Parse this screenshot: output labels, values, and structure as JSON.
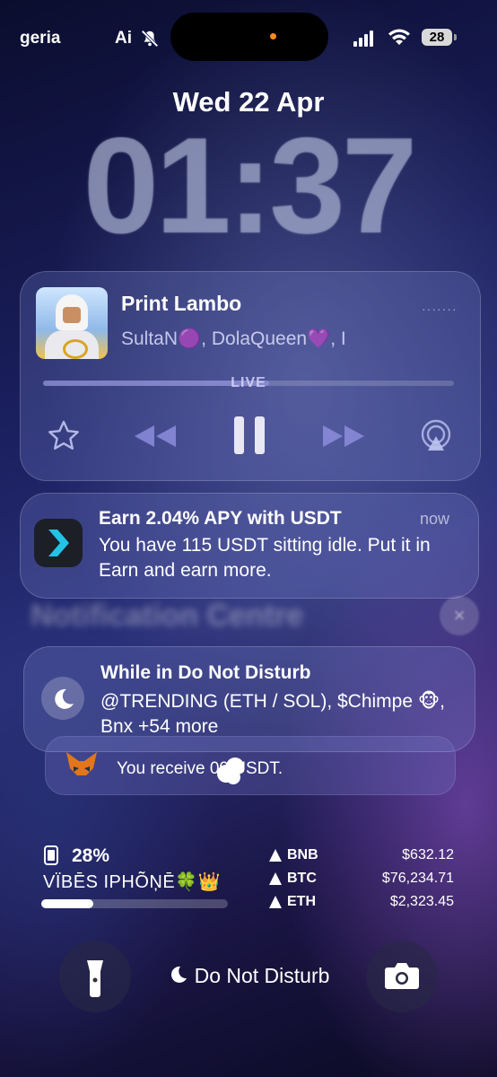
{
  "status_bar": {
    "carrier": "geria",
    "ai_label": "Ai",
    "battery_level": "28",
    "signal_bars": 4
  },
  "lock_screen": {
    "date": "Wed 22 Apr",
    "time": "01:37"
  },
  "now_playing": {
    "title": "Print Lambo",
    "artists": "SultaN🟣, DolaQueen💜, I",
    "live_label": "LIVE",
    "progress": 0.55,
    "controls": [
      "star-icon",
      "rewind-icon",
      "pause-icon",
      "fast-forward-icon",
      "airplay-icon"
    ]
  },
  "notification": {
    "title": "Earn 2.04% APY with USDT",
    "time": "now",
    "body": "You have 115 USDT sitting idle. Put it in Earn and earn more."
  },
  "notification_centre": {
    "label": "Notification Centre",
    "close": "×"
  },
  "dnd_stack": {
    "title": "While in Do Not Disturb",
    "body": "@TRENDING (ETH / SOL), $Chimpe 🐵, Bnx +54 more",
    "behind_text": "You receive  00 USDT."
  },
  "battery_widget": {
    "percent": "28%",
    "device_name": "VÏBĒS IPHÕŅĒ🍀👑",
    "level": 0.28
  },
  "crypto": [
    {
      "symbol": "BNB",
      "price": "$632.12"
    },
    {
      "symbol": "BTC",
      "price": "$76,234.71"
    },
    {
      "symbol": "ETH",
      "price": "$2,323.45"
    }
  ],
  "bottom": {
    "focus_label": "Do Not Disturb"
  },
  "colors": {
    "accent_orange": "#ff8a1d",
    "card_tint": "#7882c8"
  }
}
